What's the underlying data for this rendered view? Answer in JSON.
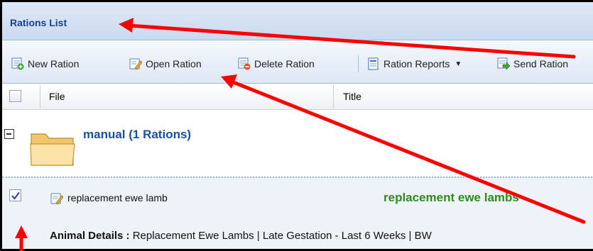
{
  "panel": {
    "title": "Rations List"
  },
  "toolbar": {
    "new_ration": "New Ration",
    "open_ration": "Open Ration",
    "delete_ration": "Delete Ration",
    "ration_reports": "Ration Reports",
    "send_ration": "Send Ration"
  },
  "columns": {
    "file": "File",
    "title": "Title"
  },
  "group": {
    "label": "manual (1 Rations)"
  },
  "row": {
    "checked": true,
    "file": "replacement ewe lamb",
    "title": "replacement ewe lambs",
    "details_label": "Animal Details :",
    "details_value": "Replacement Ewe Lambs | Late Gestation - Last 6 Weeks | BW"
  },
  "colors": {
    "title_text": "#15428b",
    "group_text": "#1b4fa0",
    "row_title": "#2e8b1e",
    "annotation_arrow": "#ff0000"
  }
}
